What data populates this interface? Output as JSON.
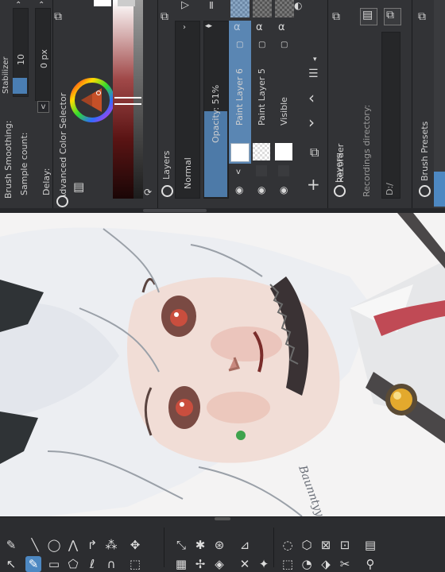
{
  "stabilizer": {
    "brush_smoothing_label": "Brush Smoothing:",
    "stabilizer_label": "Stabilizer",
    "sample_count_label": "Sample count:",
    "sample_count_value": "10",
    "delay_label": "Delay:",
    "delay_value": "0 px",
    "delay_checkbox": "v"
  },
  "color_selector": {
    "title": "Advanced Color Selector"
  },
  "layers": {
    "title": "Layers",
    "blend_mode": "Normal",
    "opacity_label": "Opacity: 51%",
    "opacity_percent": 51,
    "items": [
      {
        "name": "Paint Layer 6",
        "selected": true
      },
      {
        "name": "Paint Layer 5",
        "selected": false
      },
      {
        "name": "Visible",
        "selected": false
      }
    ]
  },
  "recorder": {
    "title": "Recorder",
    "recordings_label": "Recordings directory:",
    "directory_value": "D:/"
  },
  "brush_presets": {
    "title": "Brush Presets"
  },
  "colors": {
    "accent": "#4d88c2",
    "panel_bg": "#323336",
    "canvas_bg": "#f4f3f3"
  },
  "artwork": {
    "signature": "Baunntyy"
  }
}
